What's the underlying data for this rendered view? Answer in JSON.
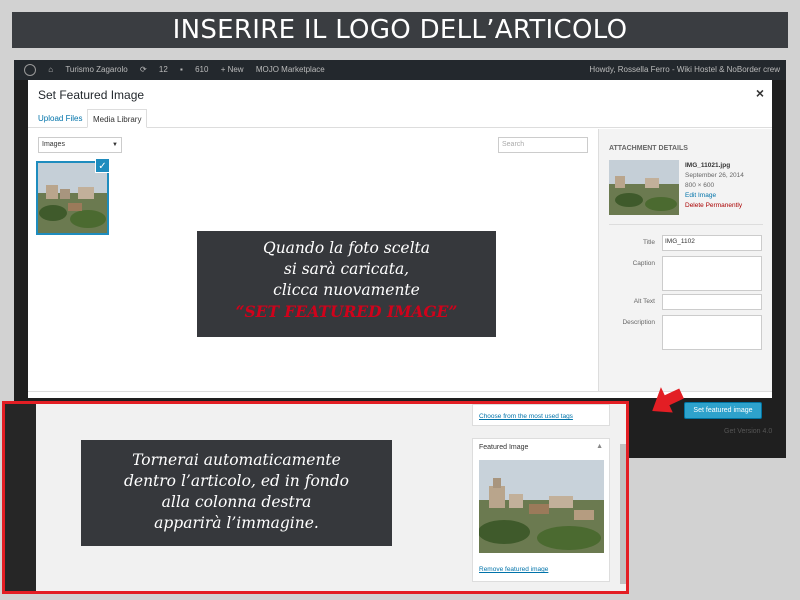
{
  "banner": {
    "title": "INSERIRE IL LOGO DELL’ARTICOLO"
  },
  "adminbar": {
    "site": "Turismo Zagarolo",
    "updates": "12",
    "comments": "610",
    "new": "+ New",
    "marketplace": "MOJO Marketplace",
    "howdy": "Howdy, Rossella Ferro - Wiki Hostel & NoBorder crew"
  },
  "modal": {
    "title": "Set Featured Image",
    "close": "×",
    "tabs": {
      "upload": "Upload Files",
      "library": "Media Library"
    },
    "filter": {
      "selected": "Images"
    },
    "search": {
      "placeholder": "Search"
    }
  },
  "attachment": {
    "heading": "ATTACHMENT DETAILS",
    "filename": "IMG_11021.jpg",
    "date": "September 26, 2014",
    "dimensions": "800 × 600",
    "edit": "Edit Image",
    "delete": "Delete Permanently",
    "fields": {
      "title_label": "Title",
      "title_value": "IMG_1102",
      "caption_label": "Caption",
      "alt_label": "Alt Text",
      "description_label": "Description"
    }
  },
  "callout1": {
    "line1": "Quando la foto scelta",
    "line2": "si sarà caricata,",
    "line3": "clicca nuovamente",
    "line4": "“SET FEATURED IMAGE”"
  },
  "callout2": {
    "line1": "Tornerai automaticamente",
    "line2": "dentro l’articolo, ed in fondo",
    "line3": "alla colonna destra",
    "line4": "apparirà l’immagine."
  },
  "panel": {
    "tags_link": "Choose from the most used tags",
    "featured_heading": "Featured Image",
    "remove_link": "Remove featured image"
  },
  "button": {
    "set_featured": "Set featured image"
  },
  "version": "Get Version 4.0",
  "colors": {
    "accent": "#2ea2cc",
    "highlight": "#e31e24",
    "callout_bg": "#36383c"
  }
}
